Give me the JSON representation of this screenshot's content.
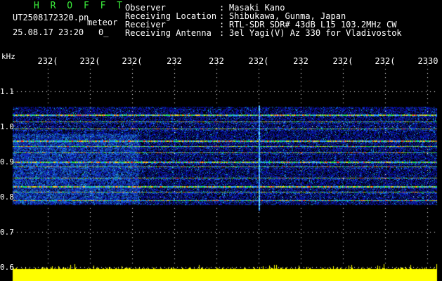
{
  "header": {
    "app_title": "H R O F F T",
    "filename": "UT2508172320.pn",
    "meteor_tag": "meteor",
    "datetime": "25.08.17 23:20",
    "count": "0_",
    "fields": [
      {
        "label": "Observer",
        "value": "Masaki Kano"
      },
      {
        "label": "Receiving Location",
        "value": "Shibukawa, Gunma, Japan"
      },
      {
        "label": "Receiver",
        "value": "RTL-SDR SDR# 43dB L15 103.2MHz CW"
      },
      {
        "label": "Receiving Antenna",
        "value": "3el Yagi(V) Az 330 for Vladivostok"
      }
    ],
    "colon": ":"
  },
  "axes": {
    "y_unit": "kHz",
    "x_ticks": [
      "232(",
      "232(",
      "232(",
      "232",
      "232",
      "232(",
      "232",
      "232(",
      "232(",
      "2330"
    ],
    "y_ticks": [
      "1.1",
      "1.0",
      "0.9",
      "0.8",
      "0.7",
      "0.6"
    ]
  },
  "spectrogram": {
    "y_range_khz": [
      0.6,
      1.1
    ],
    "signal_lines_khz": [
      1.035,
      1.015,
      0.995,
      0.96,
      0.945,
      0.925,
      0.9,
      0.885,
      0.855,
      0.83,
      0.815,
      0.79
    ],
    "meteor_burst_x_fraction": 0.58,
    "colors": {
      "background": "#000010",
      "noise": "#0a1aa8",
      "signal_hot": "#ff3010",
      "signal_warm": "#20e040",
      "level_bar": "#ffff00"
    }
  }
}
